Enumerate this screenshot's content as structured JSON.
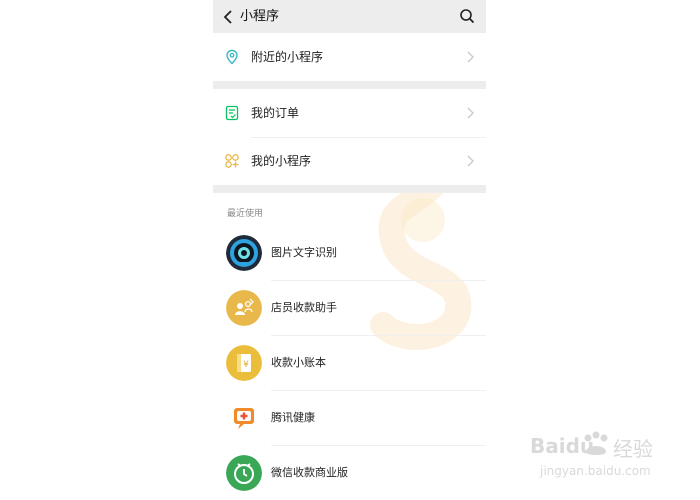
{
  "header": {
    "title": "小程序"
  },
  "menu": {
    "nearby": "附近的小程序",
    "orders": "我的订单",
    "my_apps": "我的小程序"
  },
  "recent": {
    "label": "最近使用",
    "apps": [
      {
        "name": "图片文字识别",
        "icon": "ocr-camera-icon"
      },
      {
        "name": "店员收款助手",
        "icon": "cashier-assistant-icon"
      },
      {
        "name": "收款小账本",
        "icon": "ledger-icon"
      },
      {
        "name": "腾讯健康",
        "icon": "health-cross-icon"
      },
      {
        "name": "微信收款商业版",
        "icon": "payment-clock-icon"
      }
    ]
  },
  "watermark": {
    "brand": "Baidu",
    "cn": "经验",
    "url": "jingyan.baidu.com"
  },
  "colors": {
    "accent_green": "#07c160",
    "teal": "#3bb7c4",
    "yellow": "#e8b84a",
    "orange": "#f08a2c",
    "watermark_orange": "#f6b55b"
  }
}
